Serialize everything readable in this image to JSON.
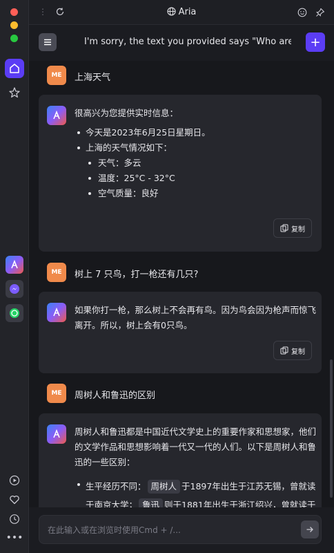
{
  "window": {
    "title": "Aria"
  },
  "header": {
    "title": "I'm sorry, the text you provided says \"Who are ..."
  },
  "messages": {
    "m1": {
      "avatar": "ME",
      "text": "上海天气"
    },
    "b1": {
      "intro": "很高兴为您提供实时信息：",
      "item1": "今天是2023年6月25日星期日。",
      "item2": "上海的天气情况如下：",
      "sub1": "天气：多云",
      "sub2": "温度：25°C - 32°C",
      "sub3": "空气质量：良好",
      "copy": "复制"
    },
    "m2": {
      "avatar": "ME",
      "text": "树上 7 只鸟，打一枪还有几只?"
    },
    "b2": {
      "text": "如果你打一枪，那么树上不会再有鸟。因为鸟会因为枪声而惊飞离开。所以，树上会有0只鸟。",
      "copy": "复制"
    },
    "m3": {
      "avatar": "ME",
      "text": "周树人和鲁迅的区别"
    },
    "b3": {
      "intro": "周树人和鲁迅都是中国近代文学史上的重要作家和思想家，他们的文学作品和思想影响着一代又一代的人们。以下是周树人和鲁迅的一些区别：",
      "item1_prefix": "生平经历不同：",
      "tag1": "周树人",
      "item1_mid": "于1897年出生于江苏无锡，曾就读于南京大学；",
      "tag2": "鲁迅",
      "item1_end": "则于1881年出生于浙江绍兴，曾就读于"
    }
  },
  "input": {
    "placeholder": "在此输入或在浏览时使用Cmd + /..."
  },
  "colors": {
    "accent": "#5b3df5",
    "me_avatar": "#f08a4b"
  }
}
